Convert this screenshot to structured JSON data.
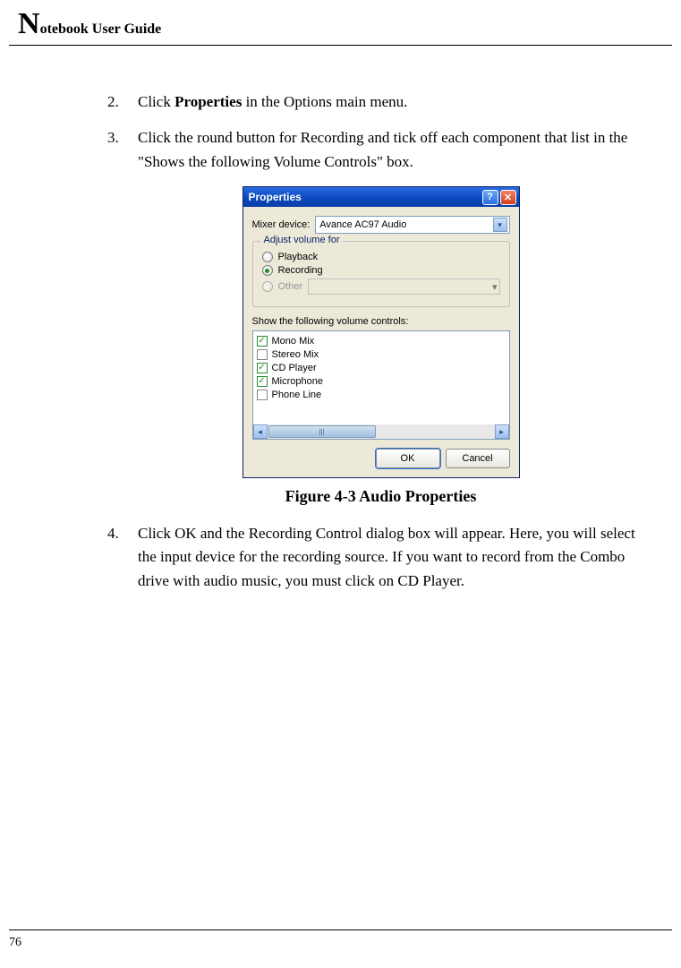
{
  "header_prefix": "N",
  "header_rest": "otebook User Guide",
  "list": {
    "item2": {
      "num": "2.",
      "before_bold": "Click ",
      "bold": "Properties",
      "after_bold": " in the Options main menu."
    },
    "item3": {
      "num": "3.",
      "text": "Click the round button for Recording and tick off each component that list in the \"Shows the following Volume Controls\" box."
    },
    "item4": {
      "num": "4.",
      "text": "Click OK and the Recording Control dialog box will appear. Here, you will select the input device for the recording source. If you want to record from the Combo drive with audio music, you must click on CD Player."
    }
  },
  "caption": "Figure 4-3   Audio Properties",
  "page_number": "76",
  "dialog": {
    "title": "Properties",
    "help": "?",
    "close": "✕",
    "mixer_label": "Mixer device:",
    "mixer_value": "Avance AC97 Audio",
    "group_legend": "Adjust volume for",
    "radios": {
      "playback": "Playback",
      "recording": "Recording",
      "other": "Other"
    },
    "show_label": "Show the following volume controls:",
    "checks": {
      "mono": "Mono Mix",
      "stereo": "Stereo Mix",
      "cd": "CD Player",
      "mic": "Microphone",
      "phone": "Phone Line"
    },
    "ok": "OK",
    "cancel": "Cancel"
  }
}
